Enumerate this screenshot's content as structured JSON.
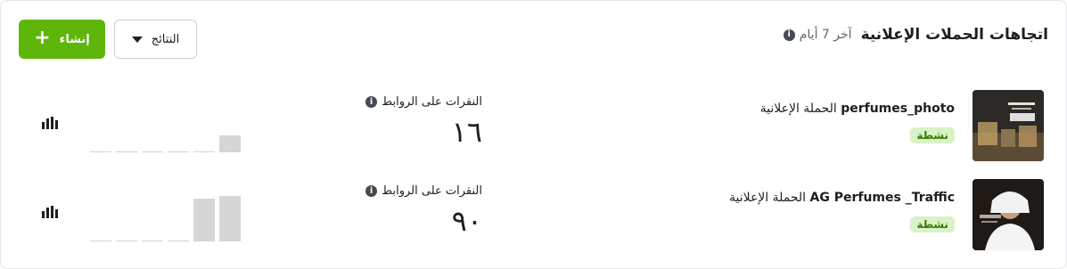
{
  "header": {
    "title": "اتجاهات الحملات الإعلانية",
    "period": "آخر 7 أيام",
    "create_label": "إنشاء",
    "results_label": "النتائج"
  },
  "campaigns": [
    {
      "prefix": "الحملة الإعلانية",
      "name": "perfumes_photo",
      "status": "نشطة",
      "metric_label": "النقرات على الروابط",
      "metric_value": "١٦",
      "trend": [
        0,
        0,
        0,
        0,
        0,
        16
      ]
    },
    {
      "prefix": "الحملة الإعلانية",
      "name": "AG Perfumes _Traffic",
      "status": "نشطة",
      "metric_label": "النقرات على الروابط",
      "metric_value": "٩٠",
      "trend": [
        0,
        0,
        0,
        0,
        42,
        45
      ]
    }
  ],
  "colors": {
    "accent": "#5fb60a",
    "badge_bg": "#d8f3c6",
    "badge_text": "#3b7a08",
    "bar": "#d6d6d6"
  }
}
